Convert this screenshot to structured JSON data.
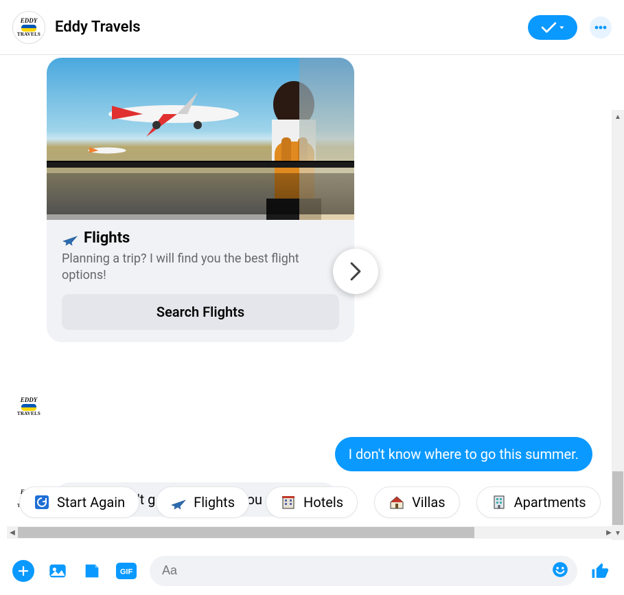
{
  "header": {
    "title": "Eddy Travels"
  },
  "card": {
    "icon": "airplane-icon",
    "title": "Flights",
    "description": "Planning a trip? I will find you the best flight options!",
    "button_label": "Search Flights"
  },
  "messages": {
    "user_text": "I don't know where to go this summer.",
    "bot_text": "Sorry, I didn't get that. Could you rephrase?"
  },
  "quick_replies": [
    {
      "icon": "restart-icon",
      "label": "Start Again"
    },
    {
      "icon": "airplane-icon",
      "label": "Flights"
    },
    {
      "icon": "hotel-icon",
      "label": "Hotels"
    },
    {
      "icon": "villa-icon",
      "label": "Villas"
    },
    {
      "icon": "apartment-icon",
      "label": "Apartments"
    }
  ],
  "composer": {
    "placeholder": "Aa"
  },
  "colors": {
    "accent": "#0a99ff",
    "bubble_bg": "#f0f2f5"
  }
}
